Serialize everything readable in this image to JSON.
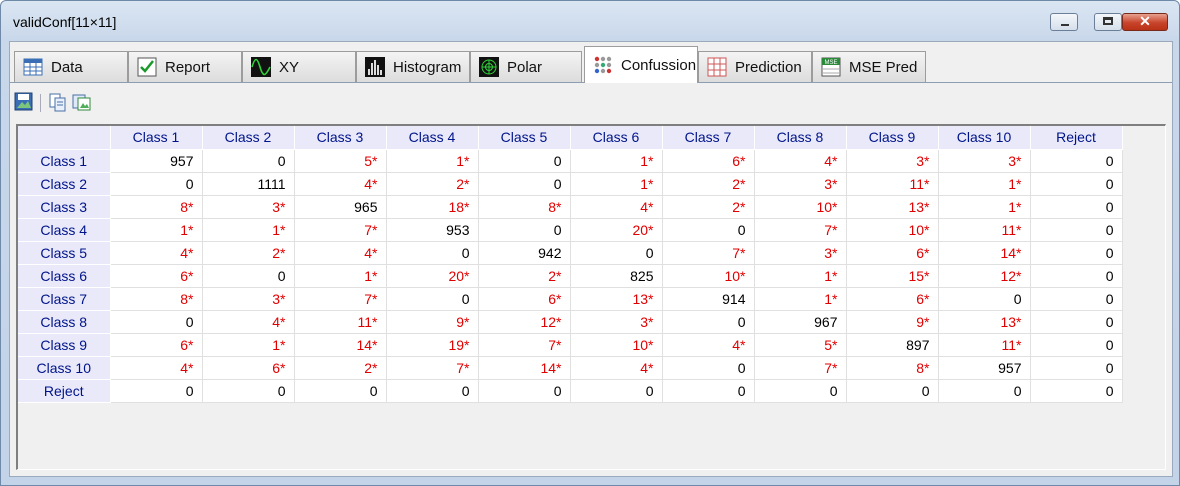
{
  "window": {
    "title": "validConf[11×11]",
    "close_glyph": "✕"
  },
  "tabs": [
    {
      "label": "Data",
      "icon": "table-icon"
    },
    {
      "label": "Report",
      "icon": "checkmark-icon"
    },
    {
      "label": "XY",
      "icon": "waveform-icon"
    },
    {
      "label": "Histogram",
      "icon": "histogram-icon"
    },
    {
      "label": "Polar",
      "icon": "polar-icon"
    },
    {
      "label": "Confussion",
      "icon": "dots-grid-icon",
      "active": true
    },
    {
      "label": "Prediction",
      "icon": "prediction-grid-icon"
    },
    {
      "label": "MSE Pred",
      "icon": "mse-icon",
      "badge": "MSE"
    }
  ],
  "toolbar": {
    "icons": [
      "save-image-icon",
      "copy-icon",
      "export-image-icon"
    ]
  },
  "colors": {
    "error": "#e00000",
    "header_text": "#00148a",
    "header_bg": "#e9e9f9"
  },
  "matrix": {
    "columns": [
      "Class 1",
      "Class 2",
      "Class 3",
      "Class 4",
      "Class 5",
      "Class 6",
      "Class 7",
      "Class 8",
      "Class 9",
      "Class 10",
      "Reject"
    ],
    "rows": [
      {
        "label": "Class 1",
        "cells": [
          "957",
          "0",
          "5*",
          "1*",
          "0",
          "1*",
          "6*",
          "4*",
          "3*",
          "3*",
          "0"
        ]
      },
      {
        "label": "Class 2",
        "cells": [
          "0",
          "1111",
          "4*",
          "2*",
          "0",
          "1*",
          "2*",
          "3*",
          "11*",
          "1*",
          "0"
        ]
      },
      {
        "label": "Class 3",
        "cells": [
          "8*",
          "3*",
          "965",
          "18*",
          "8*",
          "4*",
          "2*",
          "10*",
          "13*",
          "1*",
          "0"
        ]
      },
      {
        "label": "Class 4",
        "cells": [
          "1*",
          "1*",
          "7*",
          "953",
          "0",
          "20*",
          "0",
          "7*",
          "10*",
          "11*",
          "0"
        ]
      },
      {
        "label": "Class 5",
        "cells": [
          "4*",
          "2*",
          "4*",
          "0",
          "942",
          "0",
          "7*",
          "3*",
          "6*",
          "14*",
          "0"
        ]
      },
      {
        "label": "Class 6",
        "cells": [
          "6*",
          "0",
          "1*",
          "20*",
          "2*",
          "825",
          "10*",
          "1*",
          "15*",
          "12*",
          "0"
        ]
      },
      {
        "label": "Class 7",
        "cells": [
          "8*",
          "3*",
          "7*",
          "0",
          "6*",
          "13*",
          "914",
          "1*",
          "6*",
          "0",
          "0"
        ]
      },
      {
        "label": "Class 8",
        "cells": [
          "0",
          "4*",
          "11*",
          "9*",
          "12*",
          "3*",
          "0",
          "967",
          "9*",
          "13*",
          "0"
        ]
      },
      {
        "label": "Class 9",
        "cells": [
          "6*",
          "1*",
          "14*",
          "19*",
          "7*",
          "10*",
          "4*",
          "5*",
          "897",
          "11*",
          "0"
        ]
      },
      {
        "label": "Class 10",
        "cells": [
          "4*",
          "6*",
          "2*",
          "7*",
          "14*",
          "4*",
          "0",
          "7*",
          "8*",
          "957",
          "0"
        ]
      },
      {
        "label": "Reject",
        "cells": [
          "0",
          "0",
          "0",
          "0",
          "0",
          "0",
          "0",
          "0",
          "0",
          "0",
          "0"
        ]
      }
    ]
  }
}
